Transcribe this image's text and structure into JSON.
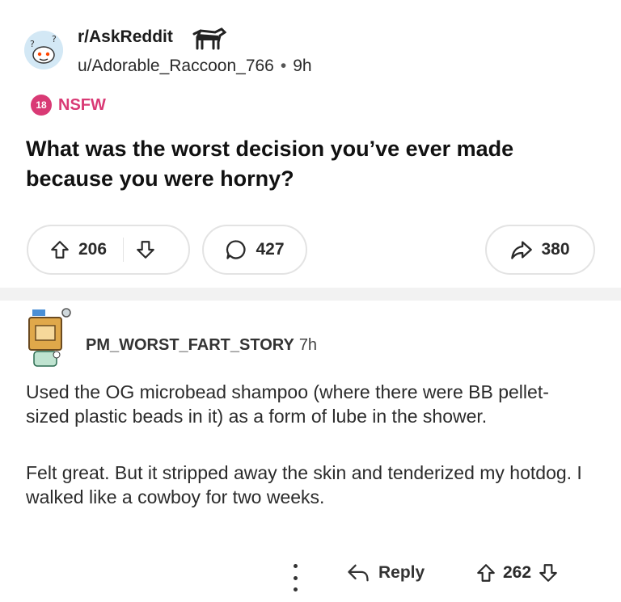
{
  "post": {
    "subreddit": "r/AskReddit",
    "author": "u/Adorable_Raccoon_766",
    "time_ago": "9h",
    "separator": "•",
    "nsfw_badge": "18",
    "nsfw_label": "NSFW",
    "title": "What was the worst decision you’ve ever made because you were horny?",
    "upvotes": "206",
    "comments": "427",
    "shares": "380"
  },
  "comment": {
    "author": "PM_WORST_FART_STORY",
    "time_ago": "7h",
    "paragraphs": [
      "Used the OG microbead shampoo (where there were BB pellet-sized plastic beads in it) as a form of lube in the shower.",
      "Felt great. But it stripped away the skin and tenderized my hotdog. I walked like a cowboy for two weeks."
    ],
    "reply_label": "Reply",
    "score": "262"
  },
  "icons": {
    "upvote": "arrow-up-outline-icon",
    "downvote": "arrow-down-outline-icon",
    "comment": "speech-bubble-icon",
    "share": "share-arrow-icon",
    "reply": "reply-arrow-icon",
    "more": "vertical-dots-icon"
  },
  "colors": {
    "nsfw": "#d93a75",
    "pill_border": "#e3e3e3",
    "divider": "#f2f2f2"
  }
}
